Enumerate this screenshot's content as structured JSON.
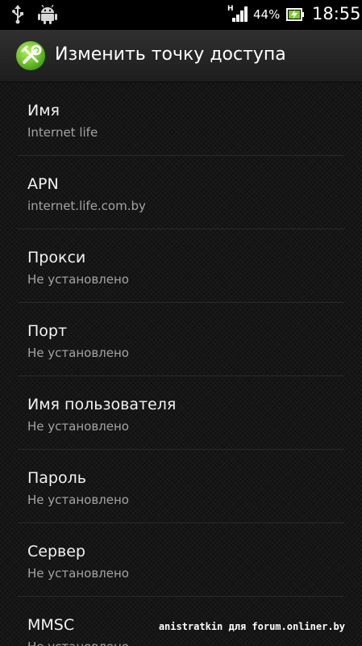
{
  "status_bar": {
    "icons": [
      "usb-icon",
      "android-debug-icon",
      "signal-icon",
      "battery-charging-icon"
    ],
    "network_type": "H",
    "battery_percent": "44%",
    "time": "18:55"
  },
  "action_bar": {
    "icon": "settings-tools-icon",
    "icon_color": "#7ccc28",
    "title": "Изменить точку доступа"
  },
  "fields": [
    {
      "label": "Имя",
      "value": "Internet life"
    },
    {
      "label": "APN",
      "value": "internet.life.com.by"
    },
    {
      "label": "Прокси",
      "value": "Не установлено"
    },
    {
      "label": "Порт",
      "value": "Не установлено"
    },
    {
      "label": "Имя пользователя",
      "value": "Не установлено"
    },
    {
      "label": "Пароль",
      "value": "Не установлено"
    },
    {
      "label": "Сервер",
      "value": "Не установлено"
    },
    {
      "label": "MMSC",
      "value": "Не установлено"
    }
  ],
  "watermark": "anistratkin для forum.onliner.by"
}
